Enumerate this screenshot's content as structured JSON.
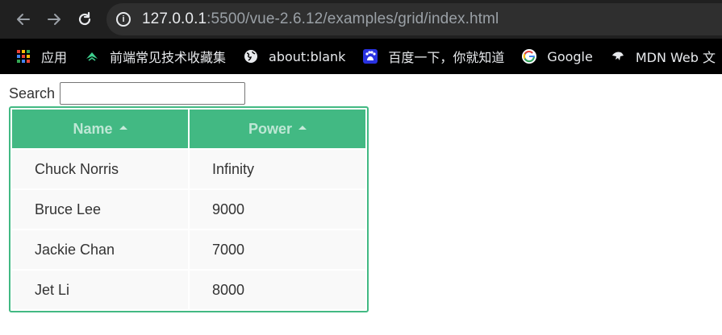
{
  "browser": {
    "url_host": "127.0.0.1",
    "url_rest": ":5500/vue-2.6.12/examples/grid/index.html",
    "bookmarks": [
      {
        "label": "应用",
        "icon": "apps-grid-icon"
      },
      {
        "label": "前端常见技术收藏集",
        "icon": "juejin-icon"
      },
      {
        "label": "about:blank",
        "icon": "globe-icon"
      },
      {
        "label": "百度一下，你就知道",
        "icon": "baidu-icon"
      },
      {
        "label": "Google",
        "icon": "google-icon"
      },
      {
        "label": "MDN Web 文",
        "icon": "mdn-icon"
      }
    ]
  },
  "search": {
    "label": "Search",
    "value": "",
    "placeholder": ""
  },
  "grid": {
    "columns": [
      {
        "label": "Name",
        "sort": "ascending"
      },
      {
        "label": "Power",
        "sort": "ascending"
      }
    ],
    "rows": [
      {
        "name": "Chuck Norris",
        "power": "Infinity"
      },
      {
        "name": "Bruce Lee",
        "power": "9000"
      },
      {
        "name": "Jackie Chan",
        "power": "7000"
      },
      {
        "name": "Jet Li",
        "power": "8000"
      }
    ]
  },
  "colors": {
    "accent": "#42b983",
    "row_background": "#f9f9f9",
    "text": "#333333"
  }
}
